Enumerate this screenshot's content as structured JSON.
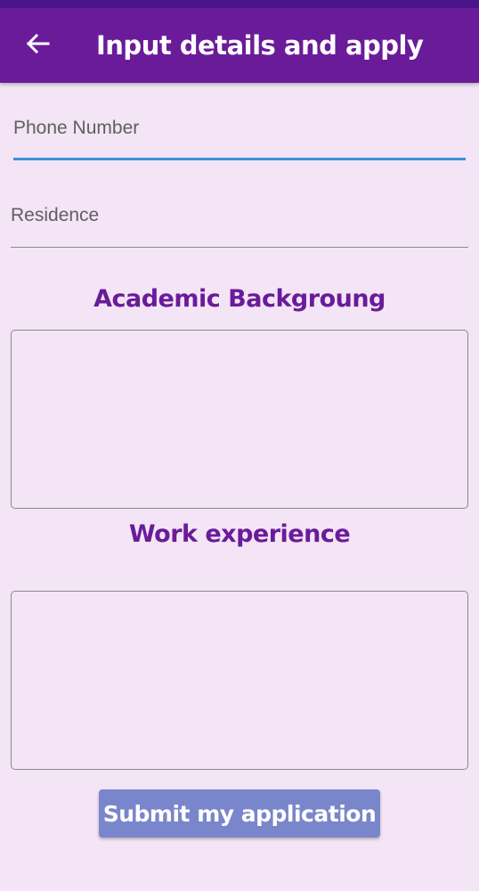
{
  "app_bar": {
    "back_icon": "arrow-left-icon",
    "title": "Input details and apply"
  },
  "form": {
    "phone": {
      "placeholder": "Phone Number",
      "value": ""
    },
    "residence": {
      "placeholder": "Residence",
      "value": ""
    },
    "academic": {
      "heading": "Academic Backgroung",
      "value": ""
    },
    "work": {
      "heading": "Work experience",
      "value": ""
    },
    "submit_label": "Submit my application"
  },
  "colors": {
    "status_bar": "#4a148c",
    "app_bar": "#6a1b9a",
    "background": "#f3e5f5",
    "heading": "#6a1b9a",
    "focus_underline": "#3d8fd9",
    "submit_button": "#7986cb"
  }
}
